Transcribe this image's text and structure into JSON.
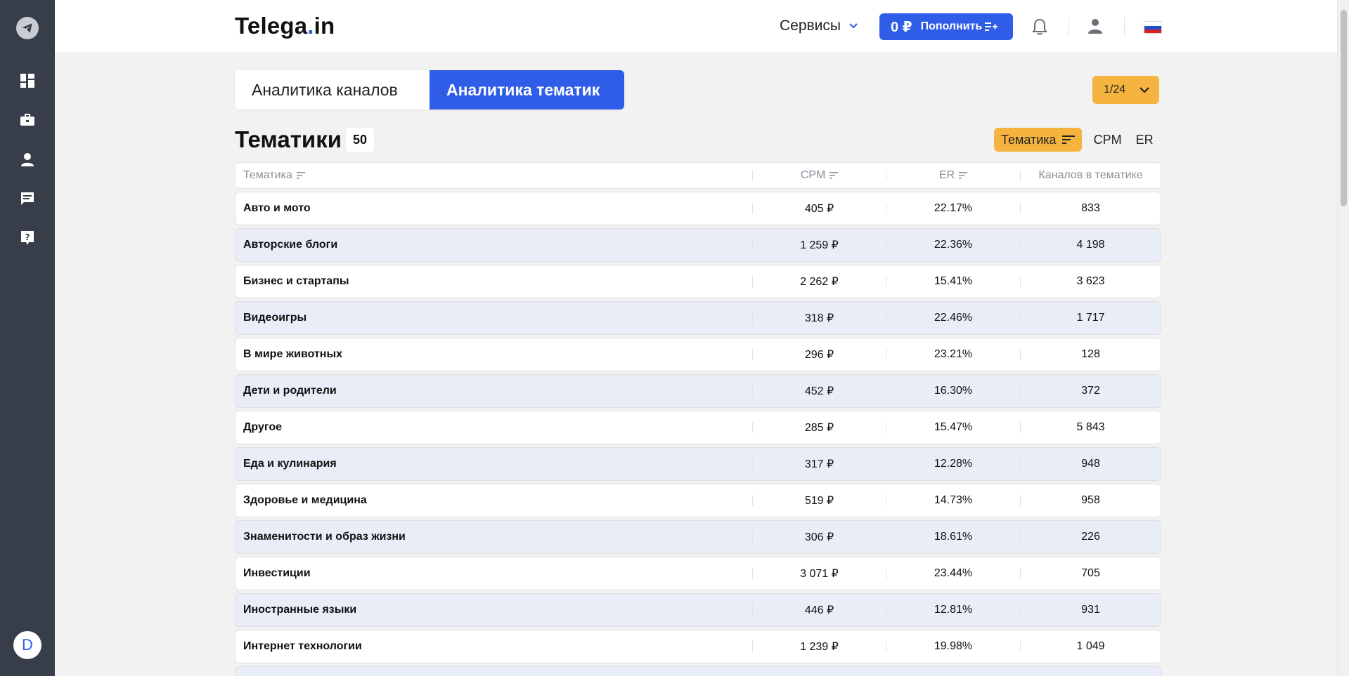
{
  "brand": {
    "name": "Telega",
    "dot": ".",
    "tld": "in"
  },
  "header": {
    "services_label": "Сервисы",
    "balance": "0 ₽",
    "topup_label": "Пополнить"
  },
  "tabs": [
    {
      "label": "Аналитика каналов",
      "active": false
    },
    {
      "label": "Аналитика тематик",
      "active": true
    }
  ],
  "pagination": {
    "current": "1/24"
  },
  "section": {
    "title": "Тематики",
    "count": "50"
  },
  "sort": {
    "active": "Тематика",
    "options": [
      "CPM",
      "ER"
    ]
  },
  "table": {
    "headers": {
      "name": "Тематика",
      "cpm": "CPM",
      "er": "ER",
      "count": "Каналов в тематике"
    },
    "rows": [
      {
        "name": "Авто и мото",
        "cpm": "405 ₽",
        "er": "22.17%",
        "count": "833"
      },
      {
        "name": "Авторские блоги",
        "cpm": "1 259 ₽",
        "er": "22.36%",
        "count": "4 198"
      },
      {
        "name": "Бизнес и стартапы",
        "cpm": "2 262 ₽",
        "er": "15.41%",
        "count": "3 623"
      },
      {
        "name": "Видеоигры",
        "cpm": "318 ₽",
        "er": "22.46%",
        "count": "1 717"
      },
      {
        "name": "В мире животных",
        "cpm": "296 ₽",
        "er": "23.21%",
        "count": "128"
      },
      {
        "name": "Дети и родители",
        "cpm": "452 ₽",
        "er": "16.30%",
        "count": "372"
      },
      {
        "name": "Другое",
        "cpm": "285 ₽",
        "er": "15.47%",
        "count": "5 843"
      },
      {
        "name": "Еда и кулинария",
        "cpm": "317 ₽",
        "er": "12.28%",
        "count": "948"
      },
      {
        "name": "Здоровье и медицина",
        "cpm": "519 ₽",
        "er": "14.73%",
        "count": "958"
      },
      {
        "name": "Знаменитости и образ жизни",
        "cpm": "306 ₽",
        "er": "18.61%",
        "count": "226"
      },
      {
        "name": "Инвестиции",
        "cpm": "3 071 ₽",
        "er": "23.44%",
        "count": "705"
      },
      {
        "name": "Иностранные языки",
        "cpm": "446 ₽",
        "er": "12.81%",
        "count": "931"
      },
      {
        "name": "Интернет технологии",
        "cpm": "1 239 ₽",
        "er": "19.98%",
        "count": "1 049"
      }
    ]
  },
  "sidebar": {
    "items": [
      "dashboard-icon",
      "briefcase-icon",
      "user-icon",
      "chat-icon",
      "help-icon"
    ],
    "avatar_letter": "D"
  },
  "colors": {
    "accent": "#2f5de8",
    "highlight": "#f5b33f",
    "sidebar": "#383d4a",
    "row_alt": "#e8edf8"
  }
}
